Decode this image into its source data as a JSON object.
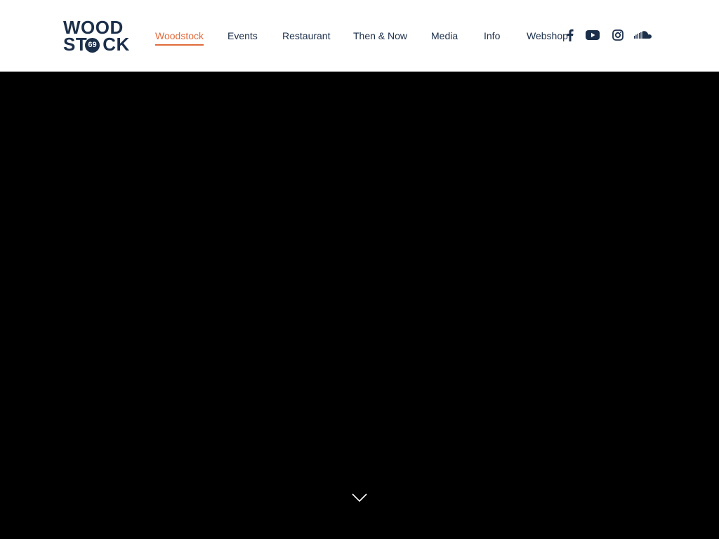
{
  "brand": {
    "logo_top": "WOOD",
    "logo_bottom_left": "ST",
    "logo_badge": "69",
    "logo_bottom_right": "CK",
    "primary_color": "#1c2f4a",
    "accent_color": "#e06a3b"
  },
  "nav": {
    "items": [
      {
        "label": "Woodstock",
        "active": true
      },
      {
        "label": "Events",
        "active": false
      },
      {
        "label": "Restaurant",
        "active": false
      },
      {
        "label": "Then & Now",
        "active": false
      },
      {
        "label": "Media",
        "active": false
      },
      {
        "label": "Info",
        "active": false
      },
      {
        "label": "Webshop",
        "active": false
      }
    ]
  },
  "social": {
    "icons": [
      "facebook-icon",
      "youtube-icon",
      "instagram-icon",
      "soundcloud-icon"
    ]
  },
  "hero": {
    "background": "#000000",
    "scroll_icon": "chevron-down-icon"
  }
}
